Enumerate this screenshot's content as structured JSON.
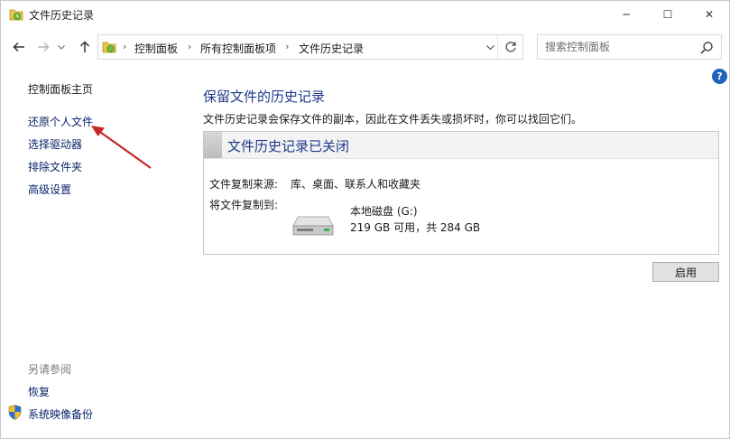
{
  "window": {
    "title": "文件历史记录",
    "minimize_glyph": "─",
    "maximize_glyph": "☐",
    "close_glyph": "✕"
  },
  "nav": {
    "back_icon": "arrow-left-icon",
    "forward_icon": "arrow-right-icon",
    "recent_icon": "chevron-down-icon",
    "up_icon": "arrow-up-icon",
    "breadcrumbs": [
      "控制面板",
      "所有控制面板项",
      "文件历史记录"
    ],
    "separator": "›",
    "search_placeholder": "搜索控制面板"
  },
  "sidebar": {
    "home": "控制面板主页",
    "items": [
      "还原个人文件",
      "选择驱动器",
      "排除文件夹",
      "高级设置"
    ],
    "see_also_label": "另请参阅",
    "see_also": [
      "恢复",
      "系统映像备份"
    ]
  },
  "main": {
    "title": "保留文件的历史记录",
    "description": "文件历史记录会保存文件的副本，因此在文件丢失或损坏时，你可以找回它们。",
    "status_title": "文件历史记录已关闭",
    "source_label": "文件复制来源:",
    "source_value": "库、桌面、联系人和收藏夹",
    "dest_label": "将文件复制到:",
    "drive_name": "本地磁盘 (G:)",
    "drive_space": "219 GB 可用，共 284 GB",
    "enable_button": "启用"
  },
  "help_glyph": "?",
  "colors": {
    "link": "#0a246a",
    "heading": "#1e3a8a",
    "annotation_arrow": "#c62828"
  }
}
